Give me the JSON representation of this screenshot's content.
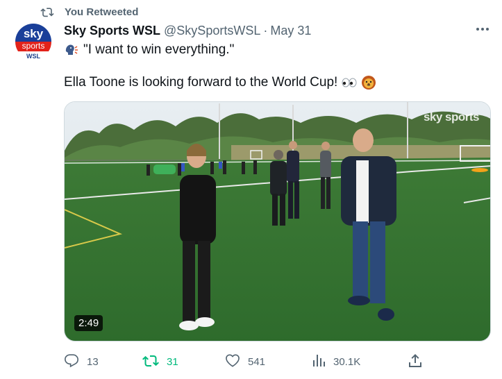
{
  "retweet_banner": {
    "label": "You Retweeted"
  },
  "author": {
    "avatar_line1": "sky",
    "avatar_line2": "sports",
    "avatar_sub": "WSL",
    "name": "Sky Sports WSL",
    "handle": "@SkySportsWSL",
    "separator": "·",
    "date": "May 31"
  },
  "tweet": {
    "line1": "\"I want to win everything.\"",
    "line2": "Ella Toone is looking forward to the World Cup!"
  },
  "media": {
    "duration": "2:49",
    "watermark": "sky sports"
  },
  "actions": {
    "replies": "13",
    "retweets": "31",
    "likes": "541",
    "views": "30.1K"
  },
  "colors": {
    "secondary_text": "#536471",
    "retweet_green": "#00ba7c",
    "sky_blue": "#1a3f99",
    "sky_red": "#e2231a"
  },
  "icons": {
    "retweet_banner": "retweet-icon",
    "speaking_head": "speaking-head-icon",
    "eyes": "eyes-icon",
    "lion": "lion-icon",
    "more": "more-icon",
    "reply": "reply-icon",
    "retweet": "retweet-icon",
    "like": "heart-icon",
    "views": "views-icon",
    "share": "share-icon"
  }
}
